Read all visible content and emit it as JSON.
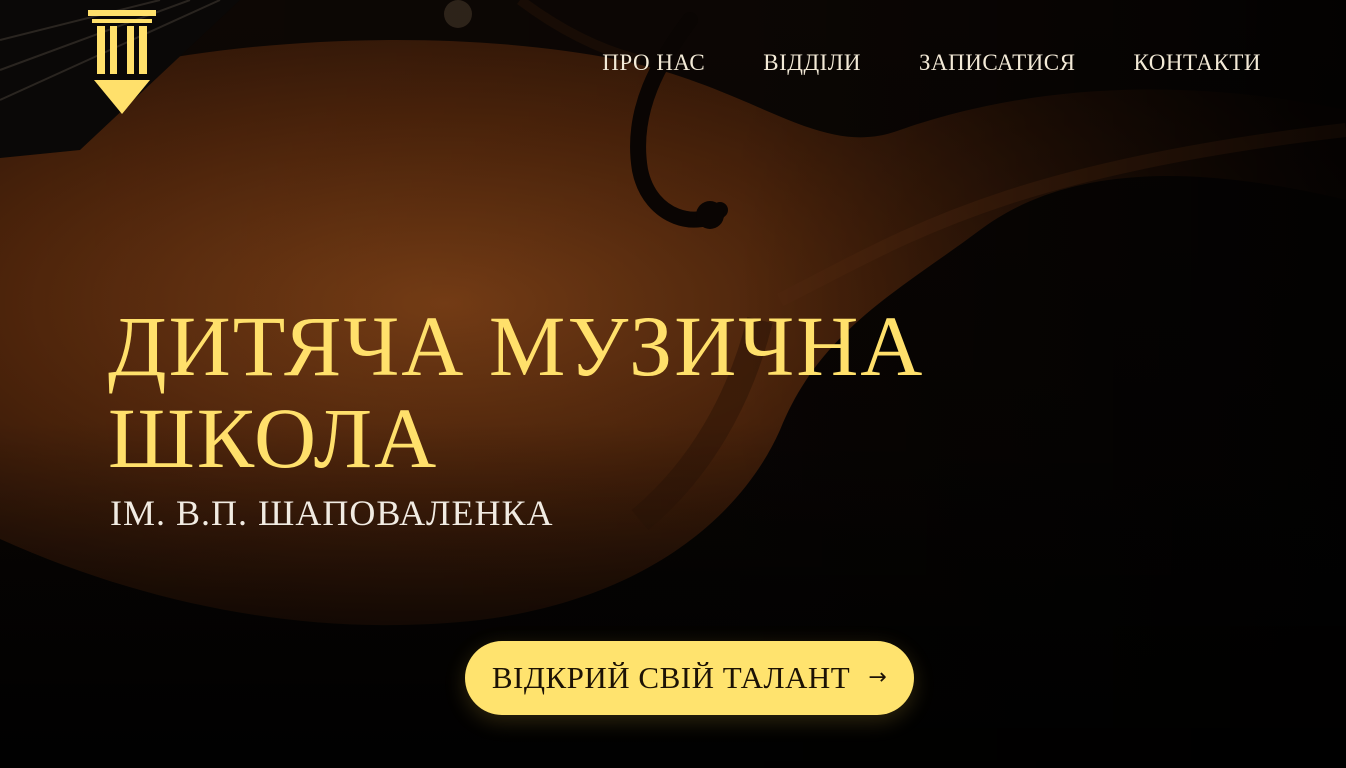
{
  "nav": {
    "items": [
      {
        "label": "ПРО НАС"
      },
      {
        "label": "ВІДДІЛИ"
      },
      {
        "label": "ЗАПИСАТИСЯ"
      },
      {
        "label": "КОНТАКТИ"
      }
    ]
  },
  "hero": {
    "title_line1": "ДИТЯЧА МУЗИЧНА",
    "title_line2": "ШКОЛА",
    "subtitle": "ІМ. В.П. ШАПОВАЛЕНКА",
    "cta_label": "ВІДКРИЙ СВІЙ ТАЛАНТ",
    "cta_icon": "arrow-right-icon"
  },
  "colors": {
    "accent": "#ffe36e",
    "title": "#ffe06b",
    "nav_text": "#f3ead7",
    "background": "#050403"
  }
}
